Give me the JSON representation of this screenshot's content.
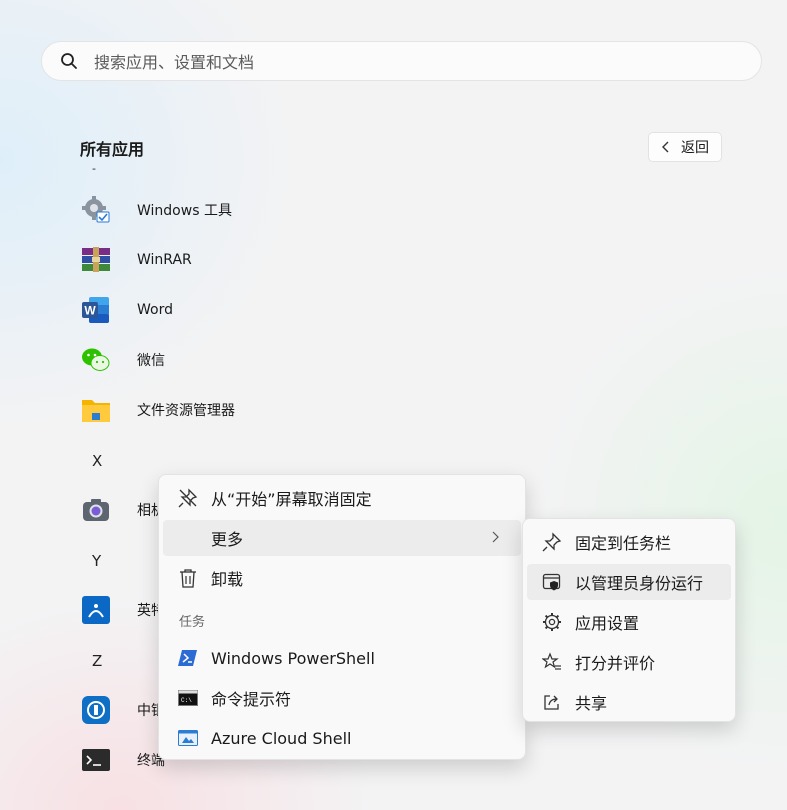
{
  "search": {
    "placeholder": "搜索应用、设置和文档",
    "icon": "search-icon"
  },
  "all_apps": {
    "title": "所有应用",
    "back_label": "返回"
  },
  "section_letters": {
    "dash": "-",
    "x": "X",
    "y": "Y",
    "z": "Z"
  },
  "apps": [
    {
      "label": "Windows 工具",
      "icon": "windows-tools-icon"
    },
    {
      "label": "WinRAR",
      "icon": "winrar-icon"
    },
    {
      "label": "Word",
      "icon": "word-icon"
    },
    {
      "label": "微信",
      "icon": "wechat-icon"
    },
    {
      "label": "文件资源管理器",
      "icon": "file-explorer-icon"
    },
    {
      "label": "相机",
      "icon": "camera-icon"
    },
    {
      "label": "英特",
      "icon": "intel-icon"
    },
    {
      "label": "中银",
      "icon": "bank-icon"
    },
    {
      "label": "终端",
      "icon": "terminal-icon"
    }
  ],
  "context_menu": {
    "items": [
      {
        "label": "从“开始”屏幕取消固定",
        "icon": "unpin-icon"
      },
      {
        "label": "更多",
        "icon": ""
      },
      {
        "label": "卸载",
        "icon": "trash-icon"
      }
    ],
    "tasks_caption": "任务",
    "tasks": [
      {
        "label": "Windows PowerShell",
        "icon": "powershell-icon"
      },
      {
        "label": "命令提示符",
        "icon": "cmd-icon"
      },
      {
        "label": "Azure Cloud Shell",
        "icon": "azure-cloud-shell-icon"
      }
    ]
  },
  "submenu": {
    "items": [
      {
        "label": "固定到任务栏",
        "icon": "pin-icon"
      },
      {
        "label": "以管理员身份运行",
        "icon": "admin-shield-icon"
      },
      {
        "label": "应用设置",
        "icon": "gear-icon"
      },
      {
        "label": "打分并评价",
        "icon": "rate-star-icon"
      },
      {
        "label": "共享",
        "icon": "share-icon"
      }
    ]
  },
  "colors": {
    "highlight": "#ececec",
    "word_blue": "#2b5797",
    "wechat_green": "#2dc100",
    "folder_yellow": "#f4b400"
  }
}
